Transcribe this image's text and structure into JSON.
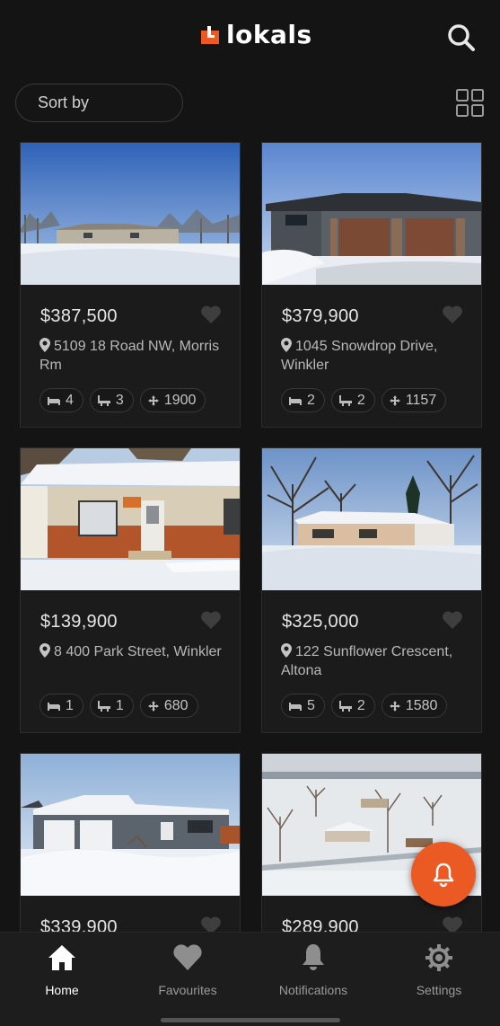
{
  "header": {
    "brand": "lokals"
  },
  "toolbar": {
    "sort_label": "Sort by"
  },
  "listings": [
    {
      "price": "$387,500",
      "address": "5109 18 Road NW, Morris Rm",
      "beds": "4",
      "baths": "3",
      "sqft": "1900"
    },
    {
      "price": "$379,900",
      "address": "1045 Snowdrop Drive, Winkler",
      "beds": "2",
      "baths": "2",
      "sqft": "1157"
    },
    {
      "price": "$139,900",
      "address": "8 400 Park Street, Winkler",
      "beds": "1",
      "baths": "1",
      "sqft": "680"
    },
    {
      "price": "$325,000",
      "address": "122 Sunflower Crescent, Altona",
      "beds": "5",
      "baths": "2",
      "sqft": "1580"
    },
    {
      "price": "$339,900"
    },
    {
      "price": "$289,900"
    }
  ],
  "tabs": [
    {
      "label": "Home",
      "icon": "home-icon"
    },
    {
      "label": "Favourites",
      "icon": "heart-icon"
    },
    {
      "label": "Notifications",
      "icon": "bell-icon"
    },
    {
      "label": "Settings",
      "icon": "gear-icon"
    }
  ],
  "colors": {
    "accent": "#ec5a24",
    "background": "#141414",
    "card": "#1b1b1b"
  }
}
